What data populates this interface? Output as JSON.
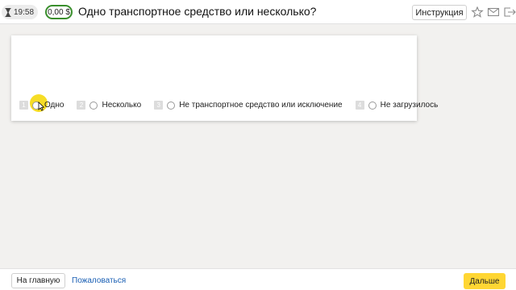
{
  "header": {
    "timer": "19:58",
    "reward": "0,00 $",
    "task_title": "Одно транспортное средство или несколько?",
    "instruction_label": "Инструкция"
  },
  "question": {
    "options": [
      {
        "key": "1",
        "label": "Одно"
      },
      {
        "key": "2",
        "label": "Несколько"
      },
      {
        "key": "3",
        "label": "Не транспортное средство или исключение"
      },
      {
        "key": "4",
        "label": "Не загрузилось"
      }
    ]
  },
  "footer": {
    "home_label": "На главную",
    "complain_label": "Пожаловаться",
    "next_label": "Дальше"
  },
  "colors": {
    "accent": "#ffd633",
    "reward_border": "#3a8f2d",
    "link": "#1a5fb4"
  },
  "icons": {
    "timer": "hourglass-icon",
    "favorite": "star-icon",
    "messages": "mail-icon",
    "exit": "exit-icon"
  }
}
